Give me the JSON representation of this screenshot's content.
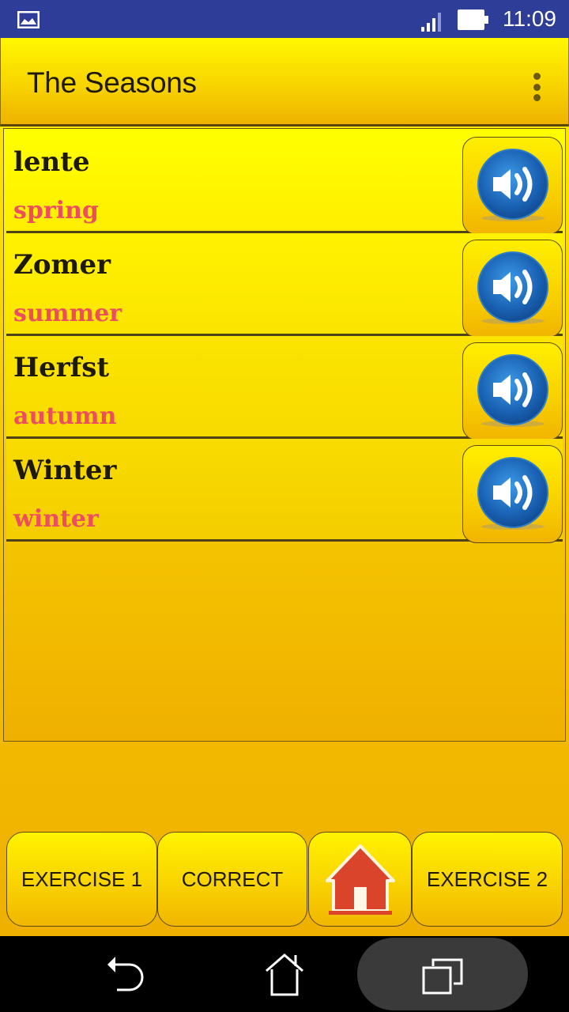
{
  "status_bar": {
    "time": "11:09",
    "icons": [
      "gallery-icon",
      "signal-icon",
      "battery-icon"
    ]
  },
  "toolbar": {
    "title": "The Seasons",
    "overflow_icon": "more-vert-icon"
  },
  "vocabulary": [
    {
      "word": "lente",
      "translation": "spring",
      "audio_icon": "speaker-icon"
    },
    {
      "word": "Zomer",
      "translation": "summer",
      "audio_icon": "speaker-icon"
    },
    {
      "word": "Herfst",
      "translation": "autumn",
      "audio_icon": "speaker-icon"
    },
    {
      "word": "Winter",
      "translation": "winter",
      "audio_icon": "speaker-icon"
    }
  ],
  "bottom_buttons": {
    "exercise1": "EXERCISE 1",
    "correct": "CORRECT",
    "home_icon": "home-icon",
    "exercise2": "EXERCISE 2"
  },
  "nav_bar": {
    "icons": [
      "back-icon",
      "home-icon",
      "recents-icon"
    ]
  },
  "colors": {
    "status_bar": "#2e3d98",
    "app_yellow": "#ffee00",
    "translation_red": "#ee4d5f",
    "speaker_blue": "#1e6fc0",
    "home_red": "#d9442a"
  }
}
